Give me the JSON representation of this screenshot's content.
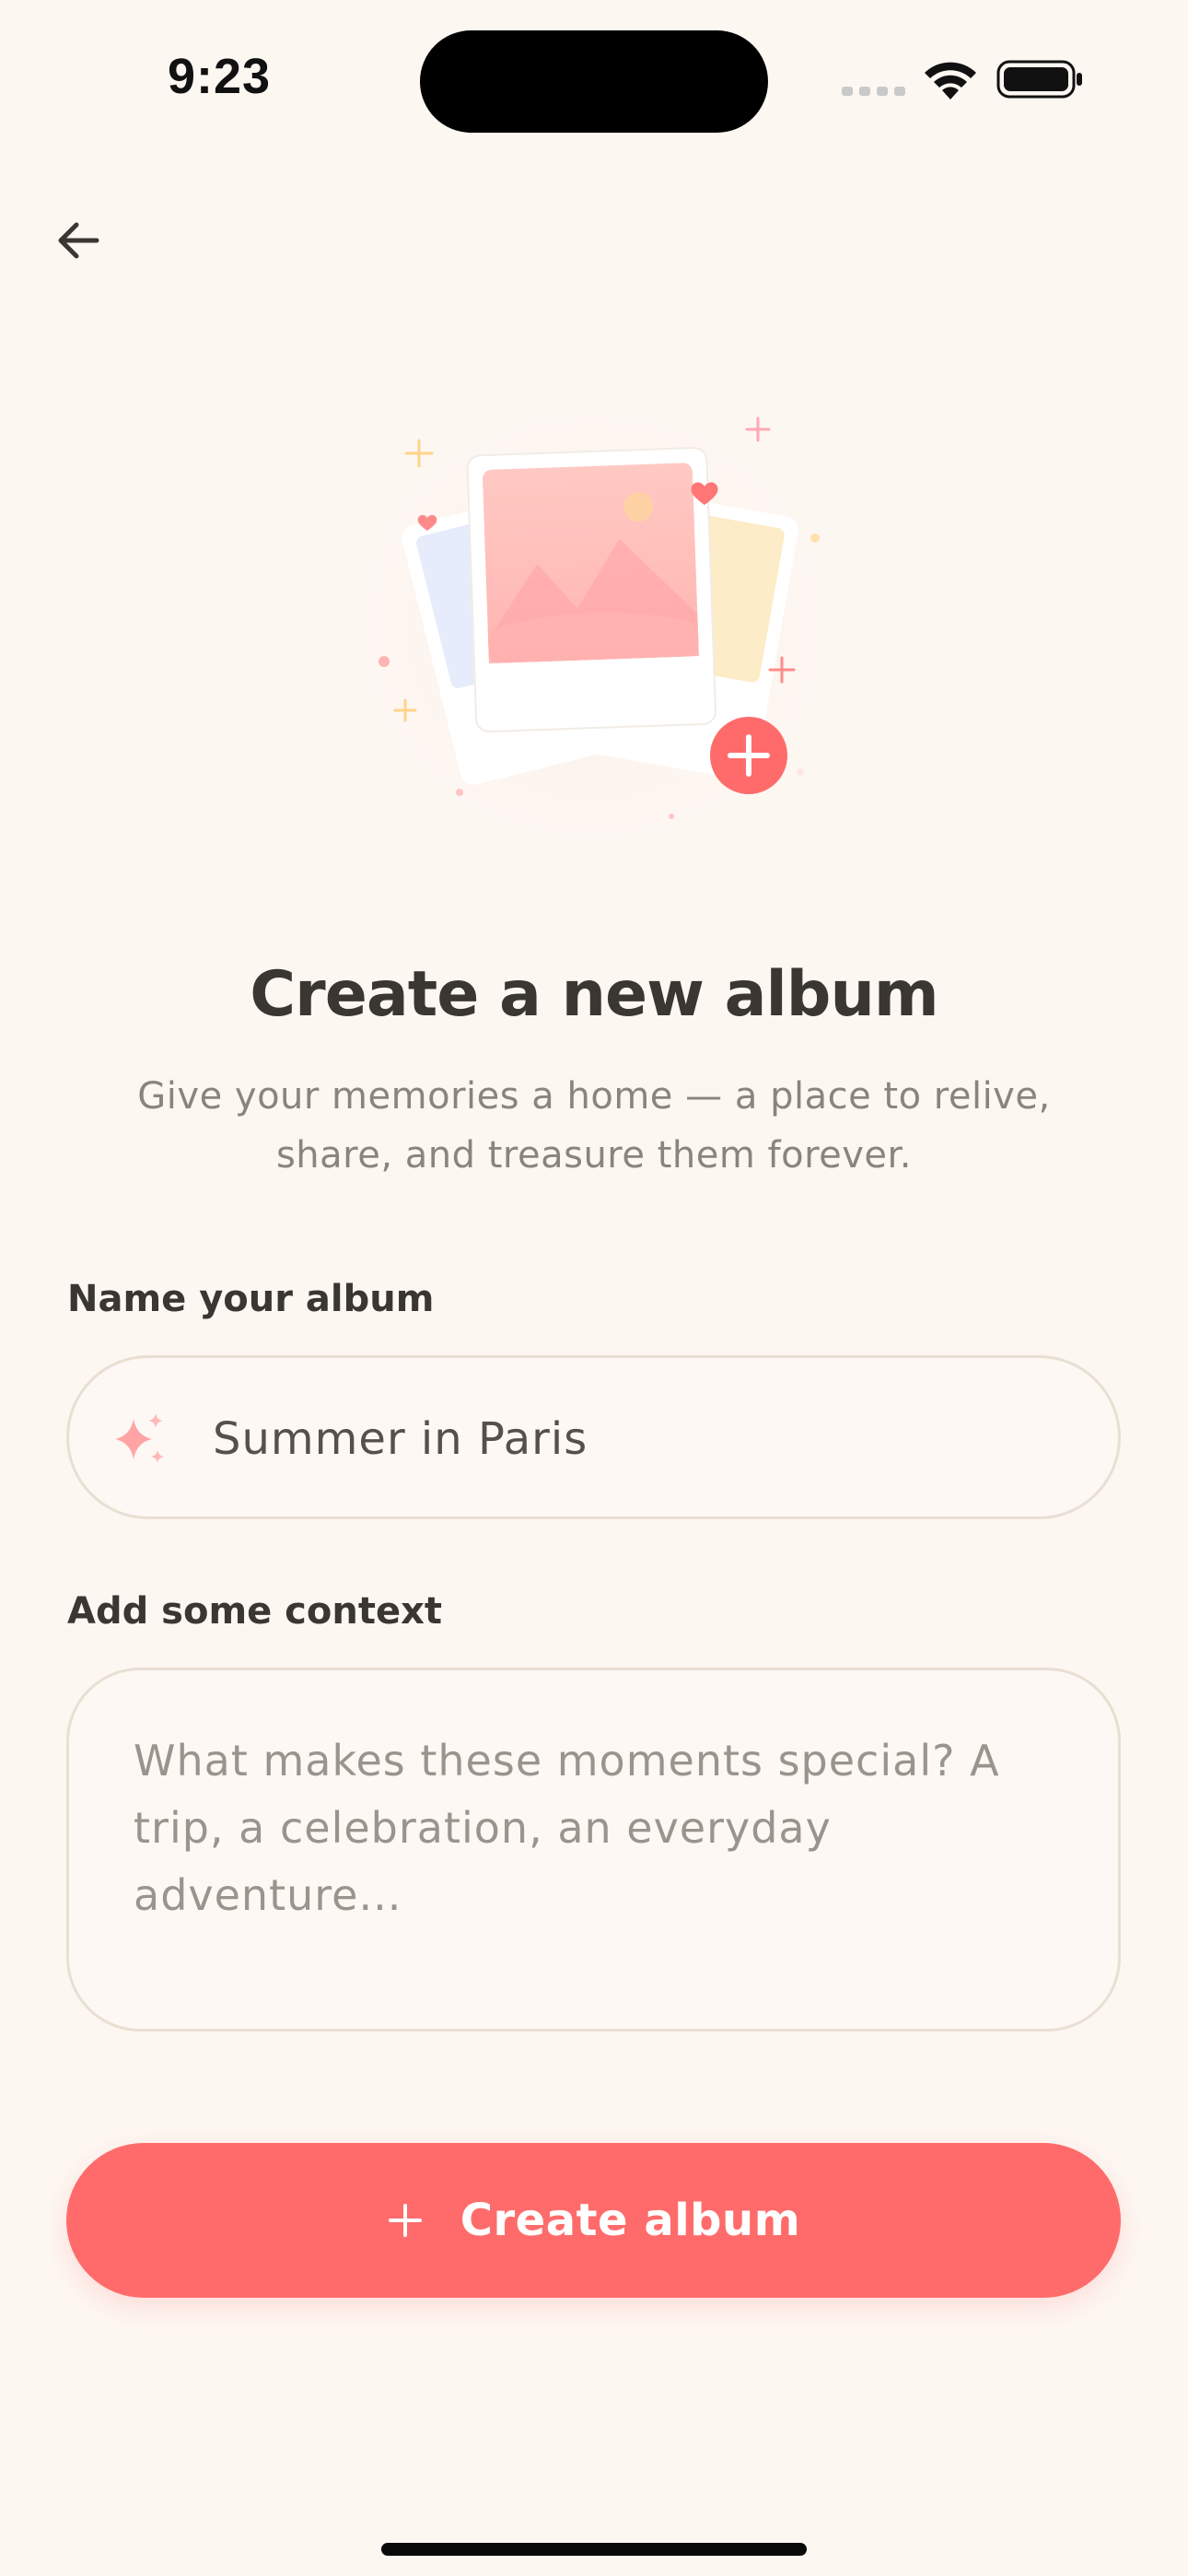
{
  "status_bar": {
    "time": "9:23",
    "icons": [
      "signal-icon",
      "wifi-icon",
      "battery-icon"
    ]
  },
  "nav": {
    "back_icon": "arrow-left-icon"
  },
  "hero": {
    "illustration": "photo-album-illustration",
    "badge_icon": "plus-icon"
  },
  "header": {
    "title": "Create a new album",
    "subtitle": "Give your memories a home — a place to relive, share, and treasure them forever."
  },
  "form": {
    "name": {
      "label": "Name your album",
      "value": "Summer in Paris",
      "icon": "sparkle-icon"
    },
    "context": {
      "label": "Add some context",
      "placeholder": "What makes these moments special? A trip, a celebration, an everyday adventure...",
      "value": ""
    }
  },
  "actions": {
    "create_label": "Create album",
    "create_icon": "plus-icon"
  },
  "colors": {
    "background": "#fdf7f2",
    "accent": "#ff6b6b",
    "title_text": "#3a3631",
    "muted_text": "#8a847d",
    "field_border": "#e9dfd2"
  }
}
